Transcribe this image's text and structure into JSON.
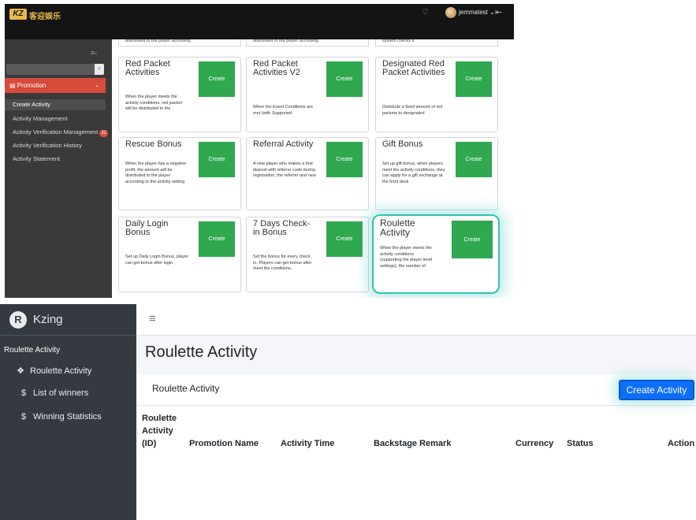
{
  "top": {
    "header": {
      "logo_mark": "KZ",
      "logo_text": "客迎娱乐",
      "bell_icon": "bell-icon",
      "username": "jemmatest",
      "user_caret": "⌄",
      "logout_icon": "logout-icon"
    },
    "sidebar": {
      "collapse_icon": "≡‹",
      "search_placeholder": "",
      "search_icon": "⌕",
      "promotion_label": "Promotion",
      "promotion_icon": "▤",
      "items": [
        {
          "label": "Create Activity"
        },
        {
          "label": "Activity Management"
        },
        {
          "label": "Activity Verification Management",
          "badge": "22"
        },
        {
          "label": "Activity Verification History"
        },
        {
          "label": "Activity Statement"
        }
      ]
    },
    "partial_cards": [
      {
        "text": "distributed to the player according"
      },
      {
        "text": "distributed to the player according"
      },
      {
        "text": "system checks if"
      }
    ],
    "cards": [
      {
        "title": "Red Packet Activities",
        "desc": "When the player meets the activity conditions, red packet will be distributed to the",
        "button": "Create"
      },
      {
        "title": "Red Packet Activities V2",
        "desc": "When the Event Conditions are met (with Supported",
        "button": "Create"
      },
      {
        "title": "Designated Red Packet Activities",
        "desc": "Distribute a fixed amount of red packets to designated",
        "button": "Create"
      },
      {
        "title": "Rescue Bonus",
        "desc": "When the player has a negative profit, the amount will be distributed to the player according to the activity setting",
        "button": "Create"
      },
      {
        "title": "Referral Activity",
        "desc": "A new player who makes a first deposit with referrer code during registration, the referrer and new",
        "button": "Create"
      },
      {
        "title": "Gift Bonus",
        "desc": "Set up gift bonus, when players meet the activity conditions, they can apply for a gift exchange at the front desk",
        "button": "Create"
      },
      {
        "title": "Daily Login Bonus",
        "desc": "Set up Daily Login Bonus, player can get bonus after login",
        "button": "Create"
      },
      {
        "title": "7 Days Check-in Bonus",
        "desc": "Set the bonus for every check in. Players can get bonus after meet the conditions.",
        "button": "Create"
      },
      {
        "title": "Roulette Activity",
        "desc": "When the player meets the activity conditions (supporting the player level settings), the number of",
        "button": "Create"
      }
    ]
  },
  "bottom": {
    "brand": {
      "logo": "R",
      "name": "Kzing"
    },
    "sidebar": {
      "section": "Roulette Activity",
      "items": [
        {
          "label": "Roulette Activity",
          "icon": "🎟"
        },
        {
          "label": "List of winners",
          "icon": "$"
        },
        {
          "label": "Winning Statistics",
          "icon": "$"
        }
      ]
    },
    "topbar": {
      "menu_icon": "≡"
    },
    "page_title": "Roulette Activity",
    "card": {
      "title": "Roulette Activity",
      "create_button": "Create Activity",
      "columns": {
        "id_line1": "Roulette",
        "id_line2": "Activity",
        "id_line3": "(ID)",
        "promotion_name": "Promotion Name",
        "activity_time": "Activity Time",
        "backstage_remark": "Backstage Remark",
        "currency": "Currency",
        "status": "Status",
        "action": "Action"
      }
    }
  }
}
